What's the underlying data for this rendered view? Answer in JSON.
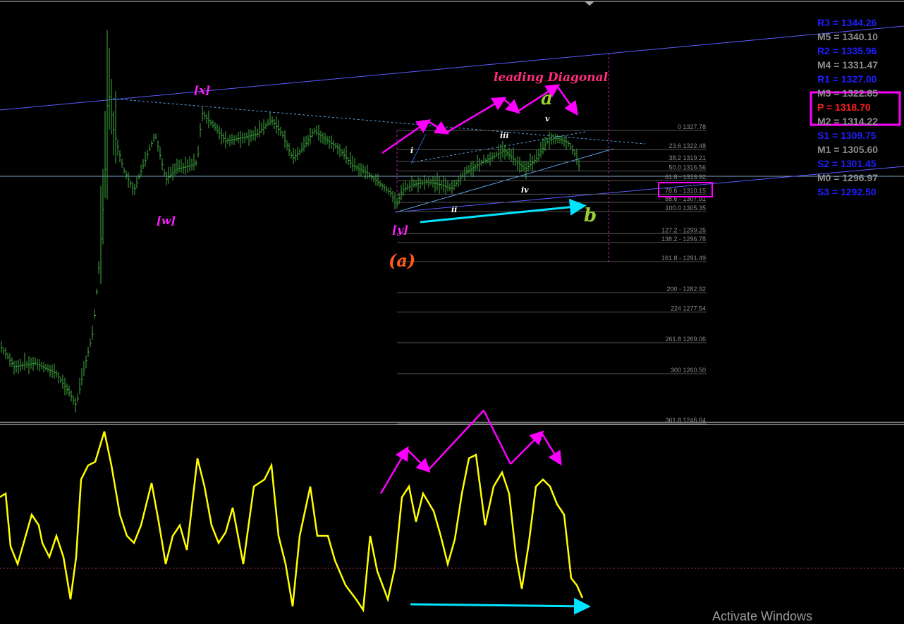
{
  "chart_data": {
    "type": "line",
    "panels": [
      "price",
      "oscillator"
    ],
    "pivots": [
      {
        "label": "R3 = 1344.26",
        "value": 1344.26,
        "color": "#1f1fff"
      },
      {
        "label": "M5 = 1340.10",
        "value": 1340.1,
        "color": "#8c8c8c"
      },
      {
        "label": "R2 = 1335.96",
        "value": 1335.96,
        "color": "#1f1fff"
      },
      {
        "label": "M4 = 1331.47",
        "value": 1331.47,
        "color": "#8c8c8c"
      },
      {
        "label": "R1 = 1327.00",
        "value": 1327.0,
        "color": "#1f1fff"
      },
      {
        "label": "M3 = 1322.85",
        "value": 1322.85,
        "color": "#8c8c8c"
      },
      {
        "label": "P = 1318.70",
        "value": 1318.7,
        "color": "#ff2020"
      },
      {
        "label": "M2 = 1314.22",
        "value": 1314.22,
        "color": "#8c8c8c"
      },
      {
        "label": "S1 = 1309.75",
        "value": 1309.75,
        "color": "#1f1fff"
      },
      {
        "label": "M1 = 1305.60",
        "value": 1305.6,
        "color": "#8c8c8c"
      },
      {
        "label": "S2 = 1301.45",
        "value": 1301.45,
        "color": "#1f1fff"
      },
      {
        "label": "M0 = 1296.97",
        "value": 1296.97,
        "color": "#8c8c8c"
      },
      {
        "label": "S3 = 1292.50",
        "value": 1292.5,
        "color": "#1f1fff"
      }
    ],
    "fib_levels": [
      {
        "label": "0 1327.78",
        "value": 1327.78
      },
      {
        "label": "23.6 1322.48",
        "value": 1322.48
      },
      {
        "label": "38.2 1319.21",
        "value": 1319.21
      },
      {
        "label": "50.0 1316.56",
        "value": 1316.56
      },
      {
        "label": "61.8 - 1313.92",
        "value": 1313.92
      },
      {
        "label": "78.6 - 1310.15",
        "value": 1310.15
      },
      {
        "label": "88.6 - 1307.91",
        "value": 1307.91
      },
      {
        "label": "100.0 1305.35",
        "value": 1305.35
      },
      {
        "label": "127.2 - 1299.25",
        "value": 1299.25
      },
      {
        "label": "138.2 - 1296.78",
        "value": 1296.78
      },
      {
        "label": "161.8 - 1291.49",
        "value": 1291.49
      },
      {
        "label": "200 - 1282.92",
        "value": 1282.92
      },
      {
        "label": "224 1277.54",
        "value": 1277.54
      },
      {
        "label": "261.8 1269.06",
        "value": 1269.06
      },
      {
        "label": "300 1260.50",
        "value": 1260.5
      },
      {
        "label": "361.8 1246.64",
        "value": 1246.64
      }
    ],
    "wave_labels": [
      {
        "text": "[x]",
        "color": "#ff20ff"
      },
      {
        "text": "[w]",
        "color": "#ff20ff"
      },
      {
        "text": "[y]",
        "color": "#ff20ff"
      },
      {
        "text": "(a)",
        "color": "#ff5a1a"
      },
      {
        "text": "a",
        "color": "#9acd32"
      },
      {
        "text": "b",
        "color": "#9acd32"
      },
      {
        "text": "i",
        "color": "#ffffff"
      },
      {
        "text": "ii",
        "color": "#ffffff"
      },
      {
        "text": "iii",
        "color": "#ffffff"
      },
      {
        "text": "iv",
        "color": "#ffffff"
      },
      {
        "text": "v",
        "color": "#ffffff"
      }
    ],
    "annotation": "leading Diagonal",
    "colors": {
      "price": "#3fae3f",
      "oscillator": "#ffff00",
      "arrows": "#ff00ff",
      "divergence": "#00e5ff",
      "trendline": "#5b5bff"
    }
  },
  "watermark": "Activate Windows"
}
